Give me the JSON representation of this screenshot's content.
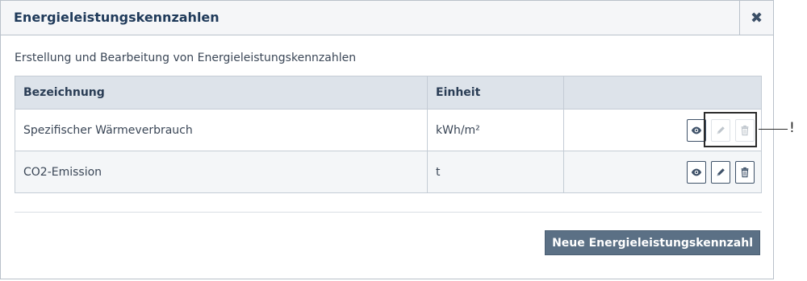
{
  "dialog": {
    "title": "Energieleistungskennzahlen",
    "close_icon": "close-icon",
    "description": "Erstellung und Bearbeitung von Energieleistungskennzahlen"
  },
  "table": {
    "columns": [
      "Bezeichnung",
      "Einheit",
      ""
    ],
    "rows": [
      {
        "name": "Spezifischer Wärmeverbrauch",
        "unit": "kWh/m²",
        "edit_enabled": false,
        "delete_enabled": false
      },
      {
        "name": "CO2-Emission",
        "unit": "t",
        "edit_enabled": true,
        "delete_enabled": true
      }
    ],
    "action_icons": [
      "eye-icon",
      "pencil-icon",
      "trash-icon"
    ]
  },
  "callout": {
    "mark": "!"
  },
  "footer": {
    "new_button_label": "Neue Energieleistungskennzahl"
  },
  "colors": {
    "header_bg": "#dde3ea",
    "primary_button": "#5b7085",
    "title": "#1f3a5a"
  }
}
